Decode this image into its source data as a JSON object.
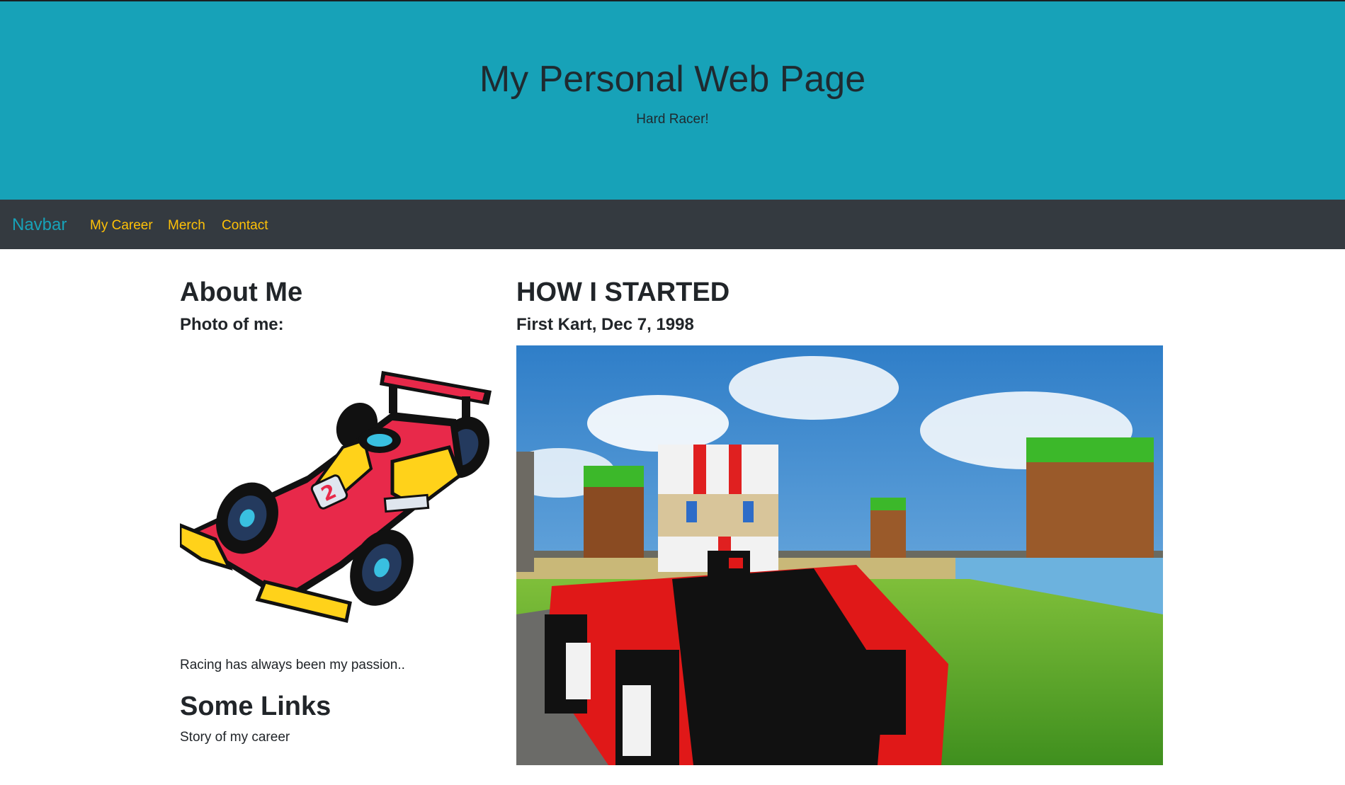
{
  "hero": {
    "title": "My Personal Web Page",
    "subtitle": "Hard Racer!"
  },
  "navbar": {
    "brand": "Navbar",
    "links": [
      "My Career",
      "Merch",
      "Contact"
    ]
  },
  "sidebar": {
    "heading": "About Me",
    "photo_label": "Photo of me:",
    "passion_text": "Racing has always been my passion..",
    "links_heading": "Some Links",
    "links": [
      "Story of my career"
    ]
  },
  "main": {
    "heading": "HOW I STARTED",
    "subheading": "First Kart, Dec 7, 1998"
  },
  "colors": {
    "hero_bg": "#17a2b8",
    "navbar_bg": "#343a40",
    "brand": "#17a2b8",
    "nav_link": "#ffc107"
  }
}
